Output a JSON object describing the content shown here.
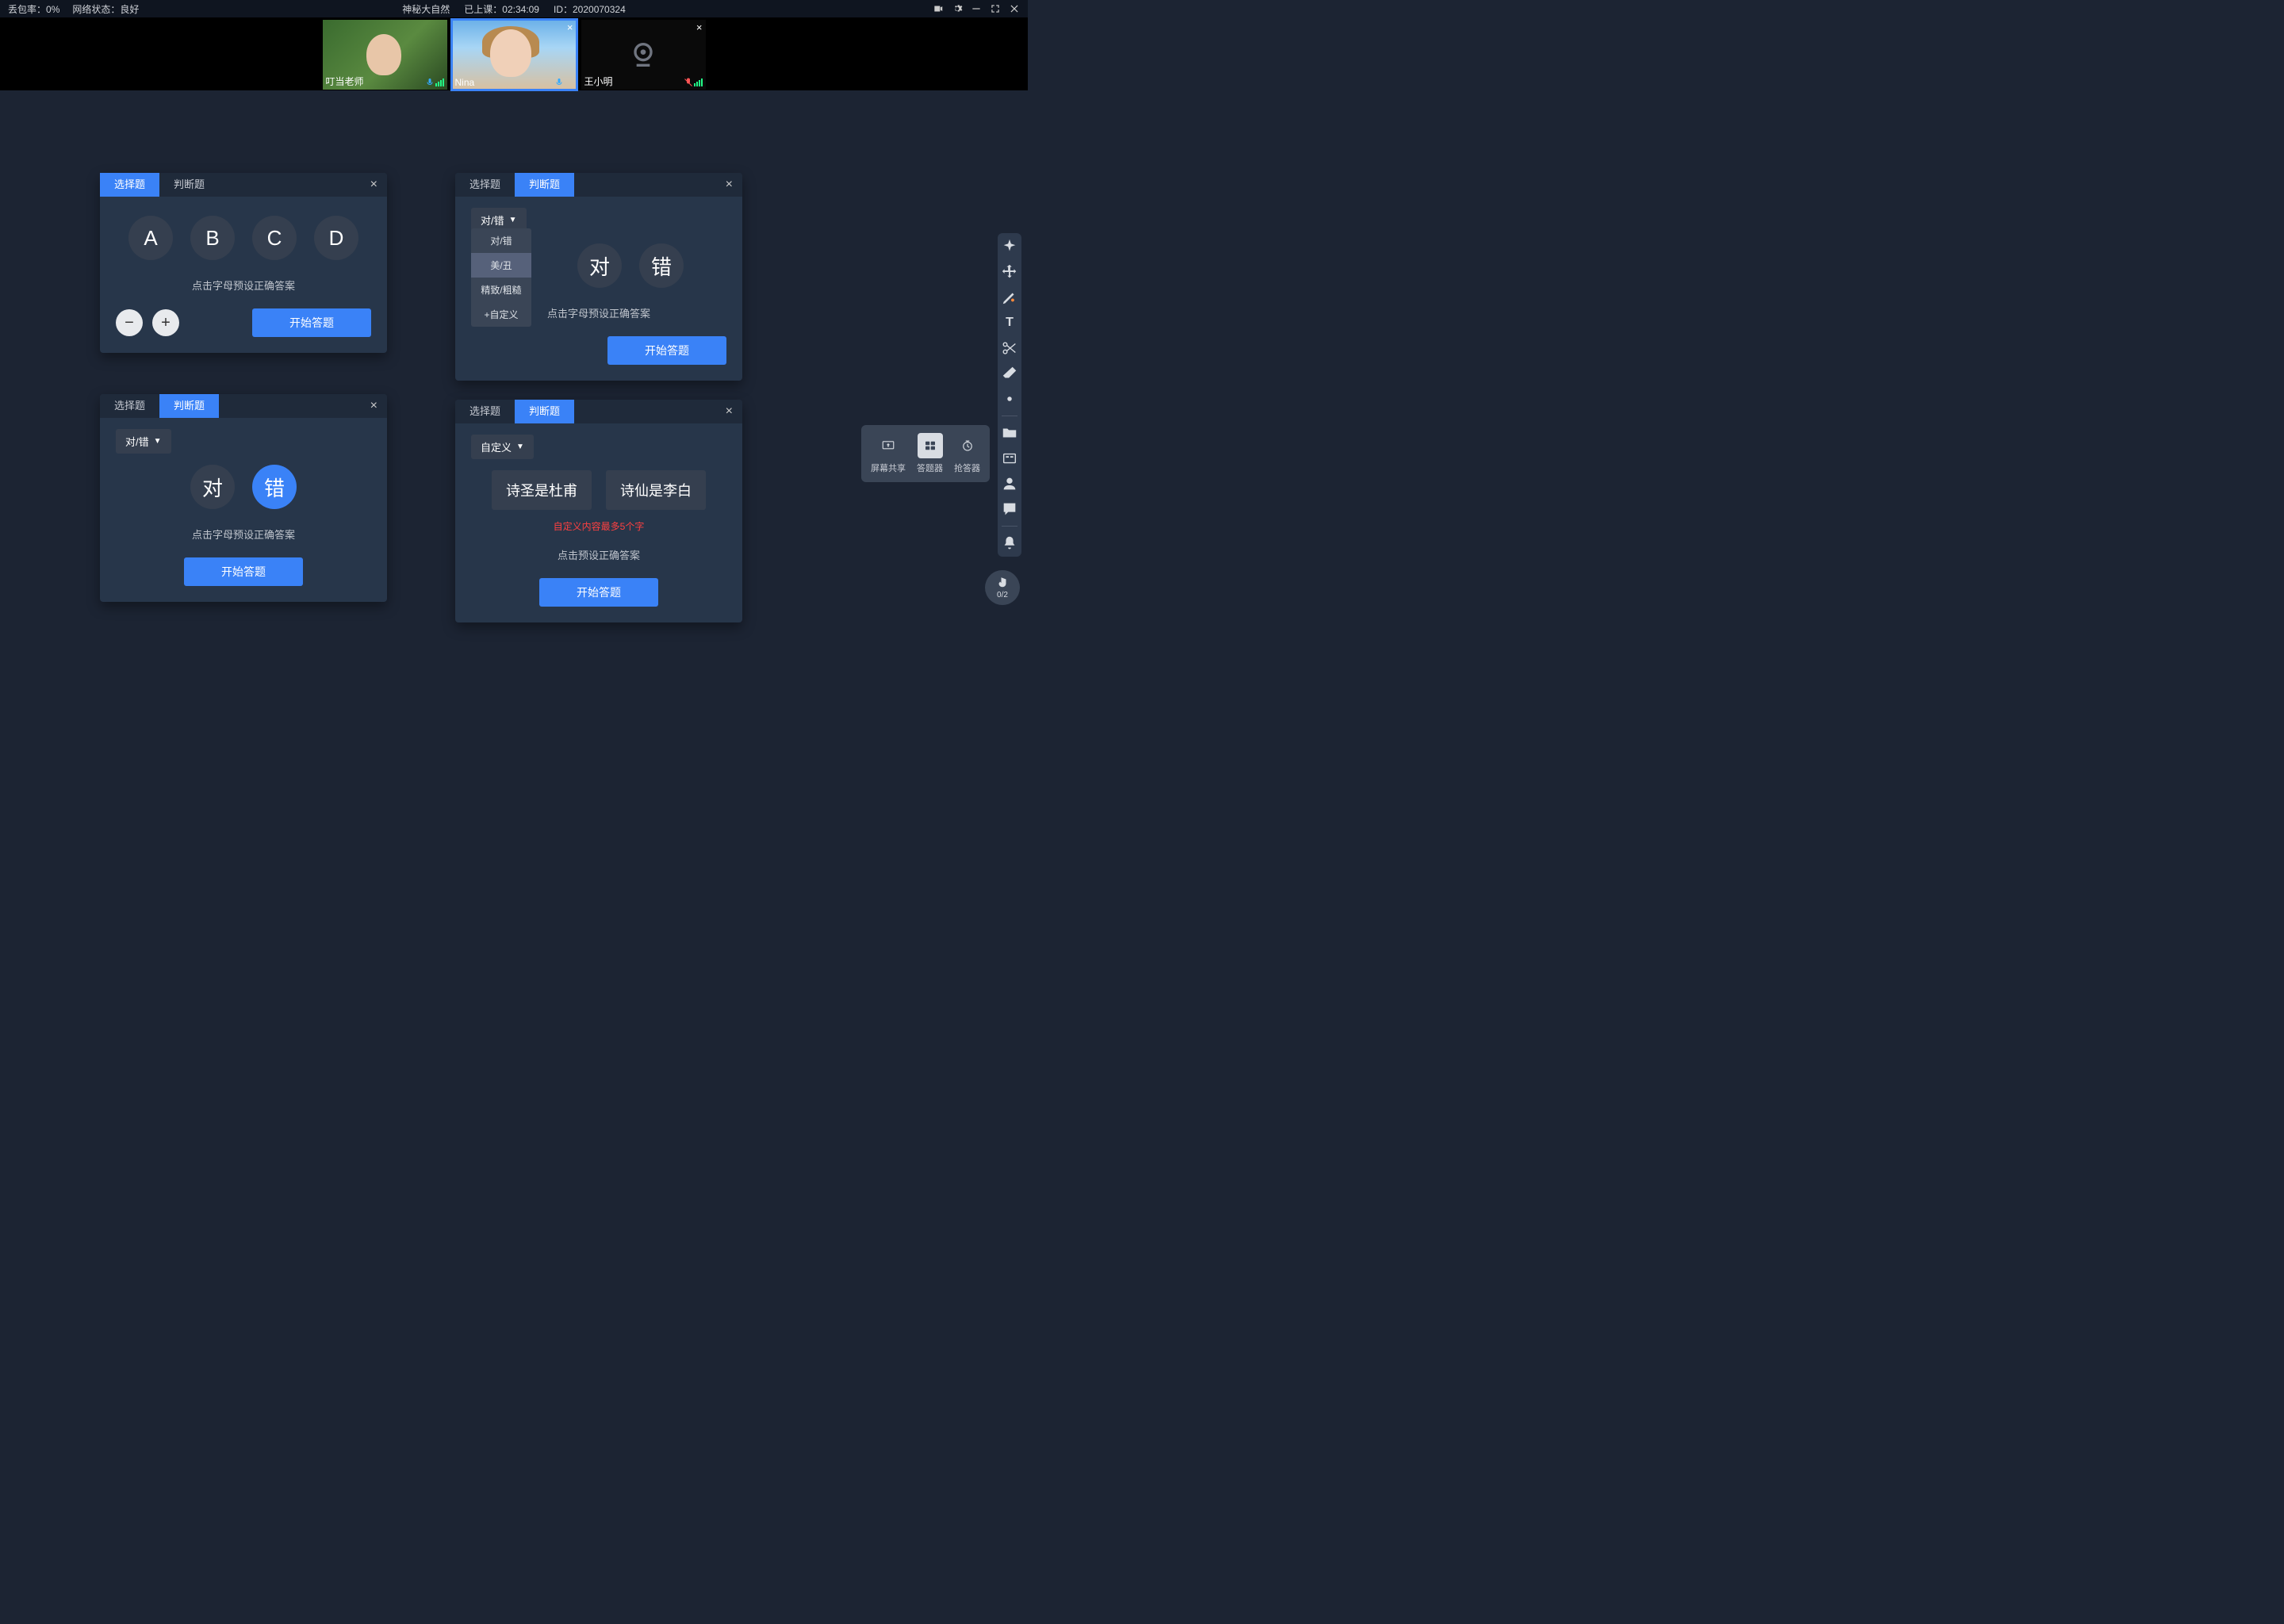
{
  "topbar": {
    "packet_loss_label": "丢包率：",
    "packet_loss_value": "0%",
    "network_label": "网络状态：",
    "network_value": "良好",
    "title": "神秘大自然",
    "elapsed_label": "已上课：",
    "elapsed_value": "02:34:09",
    "id_label": "ID：",
    "id_value": "2020070324"
  },
  "videos": [
    {
      "name": "叮当老师",
      "has_close": false,
      "active": false,
      "cam_on": true
    },
    {
      "name": "Nina",
      "has_close": true,
      "active": true,
      "cam_on": true
    },
    {
      "name": "王小明",
      "has_close": true,
      "active": false,
      "cam_on": false
    }
  ],
  "labels": {
    "tab_choice": "选择题",
    "tab_judge": "判断题",
    "hint_preset": "点击字母预设正确答案",
    "hint_preset2": "点击预设正确答案",
    "start": "开始答题",
    "minus": "−",
    "plus": "+",
    "opt_a": "A",
    "opt_b": "B",
    "opt_c": "C",
    "opt_d": "D",
    "opt_true": "对",
    "opt_false": "错",
    "dd_true_false": "对/错",
    "dd_custom": "自定义",
    "dd_items": [
      "对/错",
      "美/丑",
      "精致/粗糙",
      "+自定义"
    ],
    "chip1": "诗圣是杜甫",
    "chip2": "诗仙是李白",
    "error": "自定义内容最多5个字",
    "share_screen": "屏幕共享",
    "share_answer": "答题器",
    "share_race": "抢答器",
    "hand_count": "0/2"
  }
}
